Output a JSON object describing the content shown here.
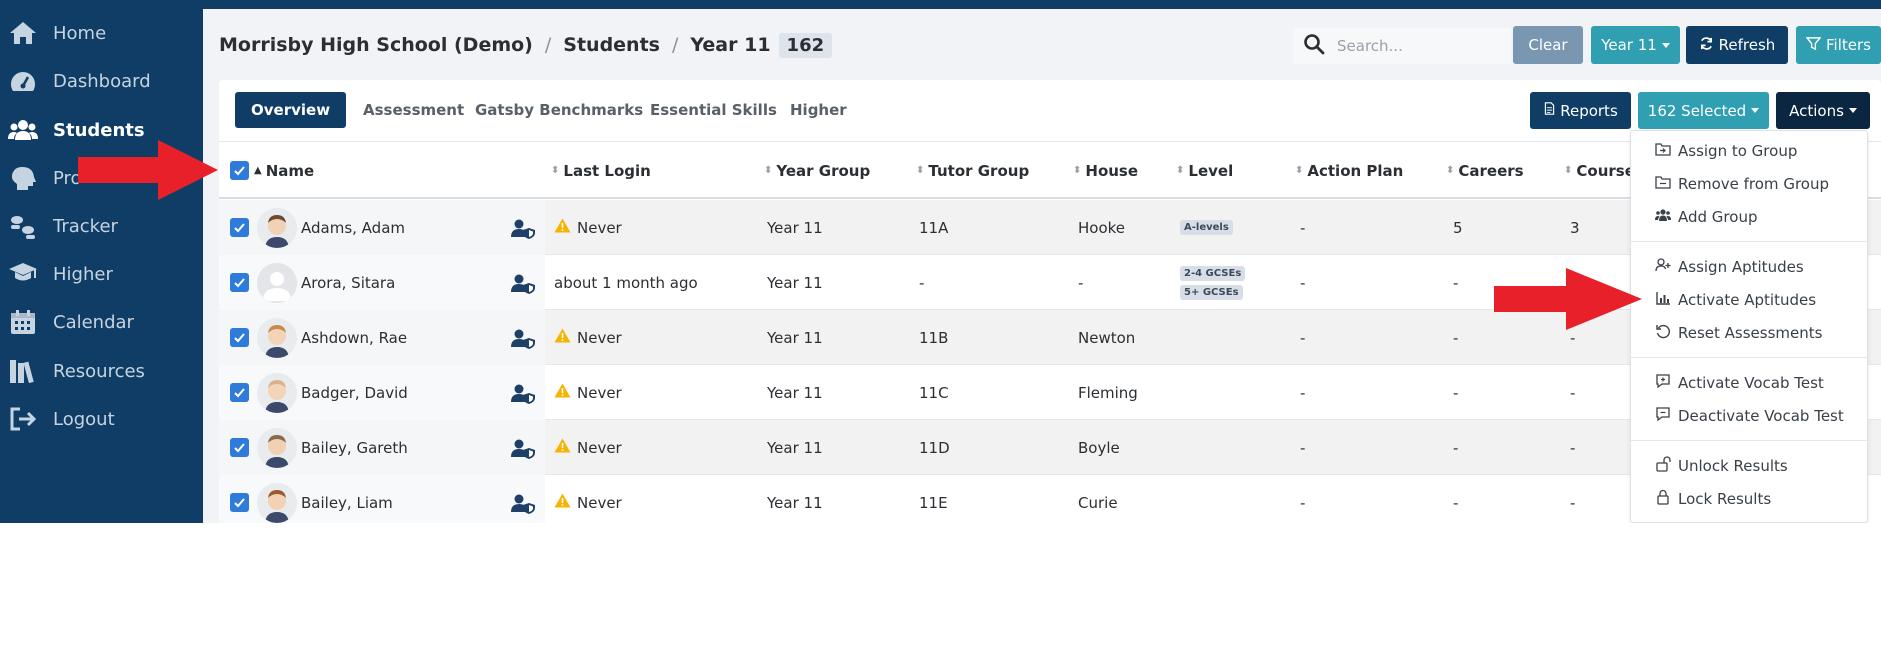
{
  "sidebar": {
    "items": [
      {
        "label": "Home",
        "icon": "home-icon"
      },
      {
        "label": "Dashboard",
        "icon": "dashboard-icon"
      },
      {
        "label": "Students",
        "icon": "students-icon"
      },
      {
        "label": "Pro",
        "icon": "profile-icon"
      },
      {
        "label": "Tracker",
        "icon": "tracker-icon"
      },
      {
        "label": "Higher",
        "icon": "graduation-icon"
      },
      {
        "label": "Calendar",
        "icon": "calendar-icon"
      },
      {
        "label": "Resources",
        "icon": "books-icon"
      },
      {
        "label": "Logout",
        "icon": "logout-icon"
      }
    ]
  },
  "breadcrumb": {
    "school": "Morrisby High School (Demo)",
    "sep1": "/",
    "section": "Students",
    "sep2": "/",
    "group": "Year 11",
    "count": "162"
  },
  "search": {
    "placeholder": "Search..."
  },
  "toolbar": {
    "clear": "Clear",
    "year": "Year 11",
    "refresh": "Refresh",
    "filters": "Filters"
  },
  "tabs": [
    "Overview",
    "Assessment",
    "Gatsby Benchmarks",
    "Essential Skills",
    "Higher"
  ],
  "card_buttons": {
    "reports": "Reports",
    "selected": "162 Selected",
    "actions": "Actions"
  },
  "table": {
    "columns": [
      "Name",
      "Last Login",
      "Year Group",
      "Tutor Group",
      "House",
      "Level",
      "Action Plan",
      "Careers",
      "Course"
    ],
    "rows": [
      {
        "name": "Adams, Adam",
        "last_login": "Never",
        "warn": true,
        "year": "Year 11",
        "tutor": "11A",
        "house": "Hooke",
        "levels": [
          "A-levels"
        ],
        "action_plan": "-",
        "careers": "5",
        "course": "3"
      },
      {
        "name": "Arora, Sitara",
        "last_login": "about 1 month ago",
        "warn": false,
        "year": "Year 11",
        "tutor": "-",
        "house": "-",
        "levels": [
          "2-4 GCSEs",
          "5+ GCSEs"
        ],
        "action_plan": "-",
        "careers": "-",
        "course": ""
      },
      {
        "name": "Ashdown, Rae",
        "last_login": "Never",
        "warn": true,
        "year": "Year 11",
        "tutor": "11B",
        "house": "Newton",
        "levels": [],
        "action_plan": "-",
        "careers": "-",
        "course": "-"
      },
      {
        "name": "Badger, David",
        "last_login": "Never",
        "warn": true,
        "year": "Year 11",
        "tutor": "11C",
        "house": "Fleming",
        "levels": [],
        "action_plan": "-",
        "careers": "-",
        "course": "-"
      },
      {
        "name": "Bailey, Gareth",
        "last_login": "Never",
        "warn": true,
        "year": "Year 11",
        "tutor": "11D",
        "house": "Boyle",
        "levels": [],
        "action_plan": "-",
        "careers": "-",
        "course": "-"
      },
      {
        "name": "Bailey, Liam",
        "last_login": "Never",
        "warn": true,
        "year": "Year 11",
        "tutor": "11E",
        "house": "Curie",
        "levels": [],
        "action_plan": "-",
        "careers": "-",
        "course": "-"
      }
    ]
  },
  "actions_menu": [
    {
      "label": "Assign to Group",
      "icon": "folder-in-icon"
    },
    {
      "label": "Remove from Group",
      "icon": "folder-out-icon"
    },
    {
      "label": "Add Group",
      "icon": "users-icon"
    },
    {
      "label": "Assign Aptitudes",
      "icon": "user-plus-icon"
    },
    {
      "label": "Activate Aptitudes",
      "icon": "bar-chart-icon"
    },
    {
      "label": "Reset Assessments",
      "icon": "reset-icon"
    },
    {
      "label": "Activate Vocab Test",
      "icon": "comment-plus-icon"
    },
    {
      "label": "Deactivate Vocab Test",
      "icon": "comment-minus-icon"
    },
    {
      "label": "Unlock Results",
      "icon": "unlock-icon"
    },
    {
      "label": "Lock Results",
      "icon": "lock-icon"
    }
  ],
  "colors": {
    "sidebar": "#0f3d66",
    "teal": "#2f9fb1",
    "slate": "#7a97b2",
    "checkbox": "#2f7bd9",
    "warning": "#f4b400",
    "arrow": "#e8202a"
  }
}
